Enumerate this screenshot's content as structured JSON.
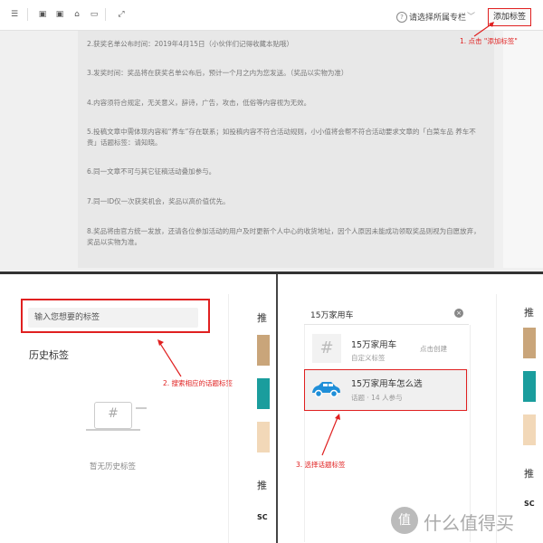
{
  "top": {
    "column_select": "请选择所属专栏",
    "add_tag_button": "添加标签",
    "annotation": "1. 点击 \"添加标签\"",
    "paragraphs": [
      "2.获奖名单公布时间：2019年4月15日（小伙伴们记得收藏本贴哦）",
      "3.发奖时间：奖品将在获奖名单公布后，预计一个月之内为您发送。（奖品以实物为准）",
      "4.内容须符合规定，无关意义，辞诗，广告，攻击，低俗等内容视为无效。",
      "5.投稿文章中需体现内容和“养车”存在联系；如投稿内容不符合活动规则，小小值将会帮不符合活动要求文章的「白菜车品 养车不贵」话题标签：请知晓。",
      "6.同一文章不可与其它征稿活动叠加参与。",
      "7.同一ID仅一次获奖机会，奖品以高价值优先。",
      "8.奖品将由官方统一发放，还请各位参加活动的用户及时更新个人中心的收货地址，因个人原因未能成功领取奖品则视为自愿放弃，奖品以实物为准。"
    ]
  },
  "left": {
    "search_placeholder": "输入您想要的标签",
    "history_title": "历史标签",
    "empty_text": "暂无历史标签",
    "annotation": "2. 搜索相应的话题标签",
    "recommend_label": "推",
    "recommend_label_2": "推",
    "cut_text": "SC"
  },
  "right": {
    "query": "15万家用车",
    "option1": {
      "title": "15万家用车",
      "sub": "自定义标签",
      "action": "点击创建"
    },
    "option2": {
      "title": "15万家用车怎么选",
      "sub": "话题 · 14 人参与"
    },
    "annotation": "3. 选择话题标签",
    "recommend_label": "推",
    "recommend_label_2": "推",
    "cut_text": "SC"
  },
  "watermark": {
    "text": "什么值得买",
    "logo": "值"
  },
  "colors": {
    "annotation_red": "#e02020",
    "car_blue": "#1f8fd8",
    "teal": "#1a9d9d"
  }
}
